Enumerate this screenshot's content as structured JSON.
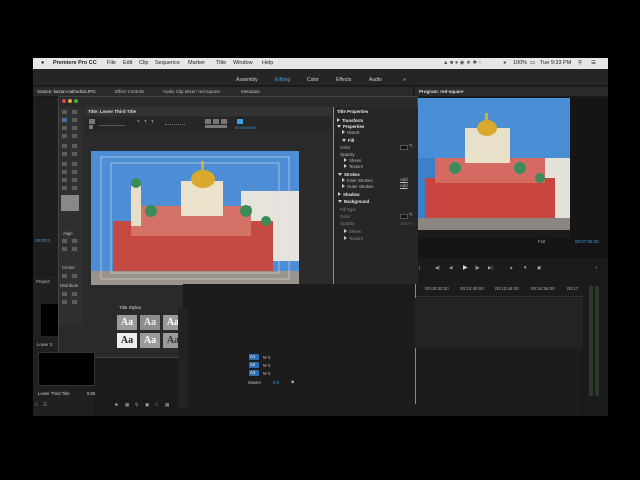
{
  "menubar": {
    "app": "Premiere Pro CC",
    "items": [
      "File",
      "Edit",
      "Clip",
      "Sequence",
      "Marker",
      "Title",
      "Window",
      "Help"
    ],
    "battery": "100%",
    "clock": "Tue 9:33 PM"
  },
  "workspaces": [
    "Assembly",
    "Editing",
    "Color",
    "Effects",
    "Audio"
  ],
  "source_panel": {
    "tabs": [
      "Source: kazan-cathedral.JPG",
      "Effect Controls",
      "Audio Clip Mixer: red-square",
      "Metadata"
    ],
    "timecode": "00;00;0"
  },
  "program_panel": {
    "title": "Program: red-square",
    "zoom": "Full",
    "timecode": "00:07:05:25"
  },
  "title_designer": {
    "title": "Title: Lower Third Title",
    "timecode": "00:00:00:00",
    "tools_align": "Align",
    "tools_center": "Center",
    "tools_distribute": "Distribute",
    "styles_header": "Title Styles",
    "style_labels": [
      "Aa",
      "Aa",
      "Aa",
      "Aa",
      "Aa",
      "Aa",
      "Aa",
      "Aa",
      "Aa",
      "Aa",
      "Aa",
      "Aa",
      "Aa",
      "Aa"
    ]
  },
  "title_properties": {
    "header": "Title Properties",
    "transform": "Transform",
    "properties": "Properties",
    "distort": "Distort",
    "fill": "Fill",
    "color": "Color",
    "opacity": "Opacity",
    "sheen": "Sheen",
    "texture": "Texture",
    "strokes": "Strokes",
    "inner_strokes": "Inner Strokes",
    "outer_strokes": "Outer Strokes",
    "add": "Add",
    "shadow": "Shadow",
    "background": "Background",
    "fill_type": "Fill Type",
    "bg_color": "Color",
    "bg_opacity": "Opacity",
    "bg_opacity_value": "100 %",
    "bg_sheen": "Sheen",
    "bg_texture": "Texture"
  },
  "project": {
    "header": "Project: ",
    "item_short": "Lower 3",
    "clip_name": "Lower Third Title",
    "clip_duration": "5:06"
  },
  "timeline": {
    "ticks": [
      "00:00:32:00",
      "00:10:40:00",
      "00:12:48:00",
      "00:34:56:00",
      "00:17"
    ],
    "tracks": [
      "A1",
      "A2",
      "A3"
    ],
    "master_label": "Master",
    "master_value": "0.0"
  }
}
